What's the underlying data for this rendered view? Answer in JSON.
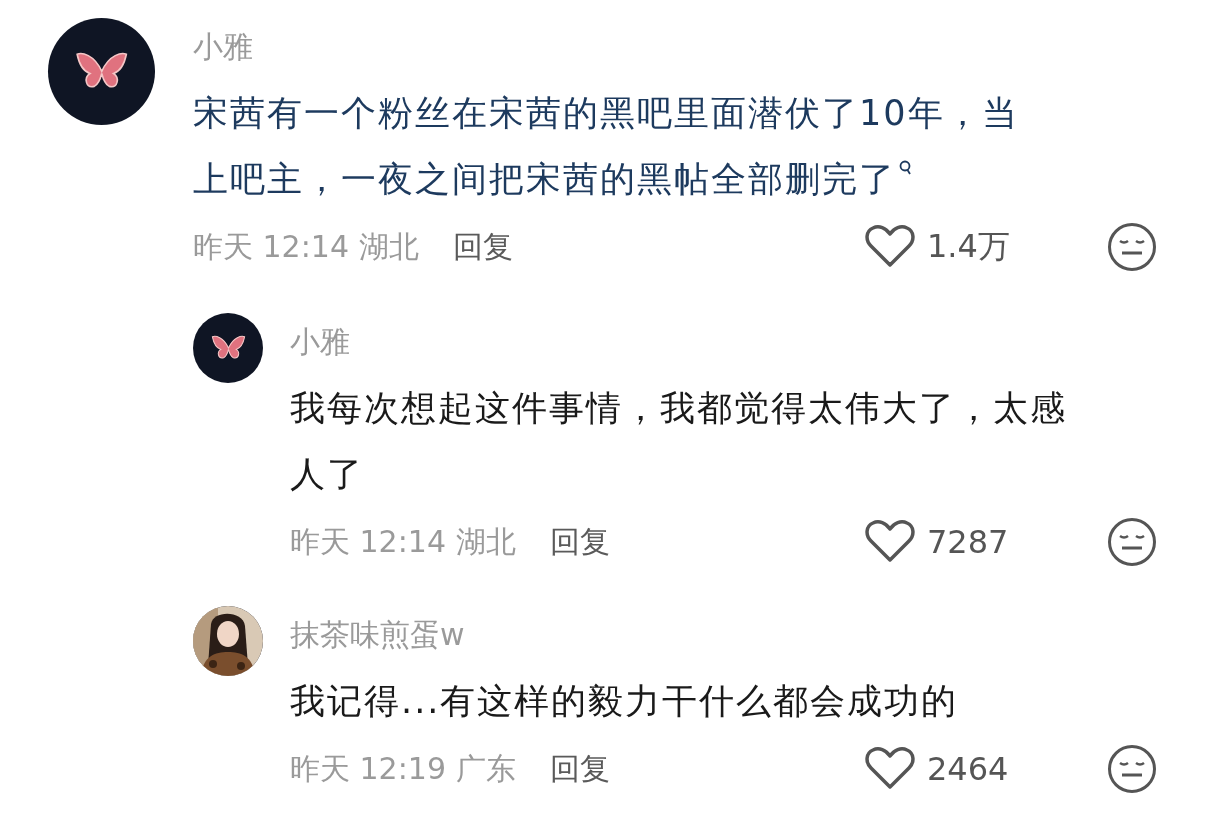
{
  "comments": [
    {
      "name": "小雅",
      "avatar": {
        "kind": "butterfly"
      },
      "text": "宋茜有一个粉丝在宋茜的黑吧里面潜伏了10年，当上吧主，一夜之间把宋茜的黑帖全部删完了",
      "search_link": true,
      "time": "昨天 12:14 湖北",
      "reply": "回复",
      "liked": false,
      "likes": "1.4万",
      "children": [
        {
          "name": "小雅",
          "avatar": {
            "kind": "butterfly"
          },
          "text": "我每次想起这件事情，我都觉得太伟大了，太感人了",
          "search_link": false,
          "time": "昨天 12:14 湖北",
          "reply": "回复",
          "liked": false,
          "likes": "7287"
        },
        {
          "name": "抹茶味煎蛋w",
          "text": "我记得...有这样的毅力干什么都会成功的",
          "search_link": false,
          "time": "昨天 12:19 广东",
          "reply": "回复",
          "liked": false,
          "likes": "2464"
        }
      ]
    }
  ]
}
